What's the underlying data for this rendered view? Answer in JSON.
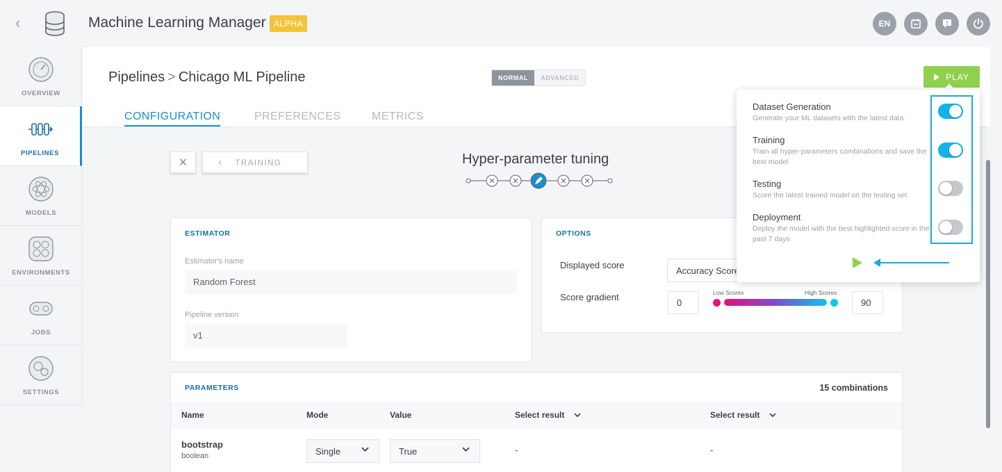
{
  "app": {
    "title": "Machine Learning Manager",
    "badge": "ALPHA",
    "top_icons": [
      {
        "label": "EN",
        "icon": "language-icon"
      },
      {
        "label": "",
        "icon": "calendar-icon"
      },
      {
        "label": "",
        "icon": "help-icon"
      },
      {
        "label": "",
        "icon": "power-icon"
      }
    ]
  },
  "sidebar": {
    "items": [
      {
        "label": "OVERVIEW",
        "icon": "gauge-icon"
      },
      {
        "label": "PIPELINES",
        "icon": "pipeline-icon"
      },
      {
        "label": "MODELS",
        "icon": "atom-icon"
      },
      {
        "label": "ENVIRONMENTS",
        "icon": "environment-icon"
      },
      {
        "label": "JOBS",
        "icon": "jobs-icon"
      },
      {
        "label": "SETTINGS",
        "icon": "gear-icon"
      }
    ],
    "active": "PIPELINES"
  },
  "header": {
    "breadcrumb_root": "Pipelines",
    "breadcrumb_sep": ">",
    "breadcrumb_current": "Chicago ML Pipeline",
    "mode_normal": "NORMAL",
    "mode_advanced": "ADVANCED",
    "play_label": "PLAY"
  },
  "tabs": [
    {
      "label": "CONFIGURATION",
      "active": true
    },
    {
      "label": "PREFERENCES",
      "active": false
    },
    {
      "label": "METRICS",
      "active": false
    }
  ],
  "wizard": {
    "close_label": "✕",
    "previous_label": "TRAINING",
    "step_title": "Hyper-parameter tuning"
  },
  "estimator": {
    "title": "ESTIMATOR",
    "name_label": "Estimator's name",
    "name_value": "Random Forest",
    "version_label": "Pipeline version",
    "version_value": "v1"
  },
  "options": {
    "title": "OPTIONS",
    "displayed_score_label": "Displayed score",
    "displayed_score_value": "Accuracy Score",
    "score_gradient_label": "Score gradient",
    "gradient_min": "0",
    "gradient_max": "90",
    "low_label": "Low Scores",
    "high_label": "High Scores",
    "colors": {
      "low": "#e8107a",
      "high": "#11c3e8"
    }
  },
  "parameters": {
    "title": "PARAMETERS",
    "combinations": "15 combinations",
    "columns": [
      "Name",
      "Mode",
      "Value",
      "Select result",
      "Select result"
    ],
    "rows": [
      {
        "name": "bootstrap",
        "type": "boolean",
        "mode": "Single",
        "value": "True",
        "result1": "-",
        "result2": "-"
      }
    ]
  },
  "play_popover": {
    "items": [
      {
        "title": "Dataset Generation",
        "desc": "Generate your ML datasets with the latest data",
        "enabled": true
      },
      {
        "title": "Training",
        "desc": "Train all hyper-parameters combinations and save the best model",
        "enabled": true
      },
      {
        "title": "Testing",
        "desc": "Score the latest trained model on the testing set",
        "enabled": false
      },
      {
        "title": "Deployment",
        "desc": "Deploy the model with the best highlighted score in the past 7 days",
        "enabled": false
      }
    ],
    "colors": {
      "toggle_on": "#11b3e8",
      "play": "#8fd14f",
      "highlight": "#1aa8e0"
    }
  }
}
